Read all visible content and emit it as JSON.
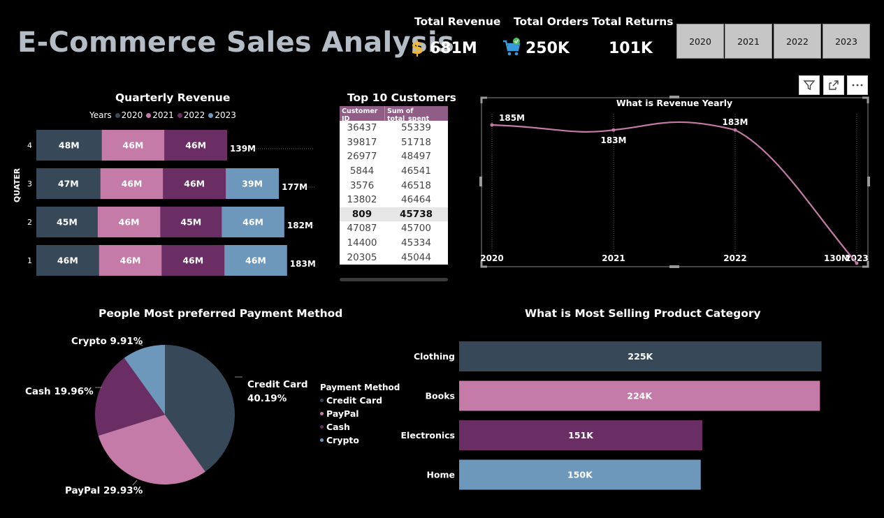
{
  "header": {
    "title": "E-Commerce Sales Analysis"
  },
  "kpis": [
    {
      "label": "Total Revenue",
      "value": "681M",
      "icon": "dollar-icon"
    },
    {
      "label": "Total Orders",
      "value": "250K",
      "icon": "cart-icon"
    },
    {
      "label": "Total Returns",
      "value": "101K"
    }
  ],
  "year_slicer": [
    "2020",
    "2021",
    "2022",
    "2023"
  ],
  "quarterly": {
    "title": "Quarterly Revenue",
    "legend_title": "Years",
    "axis_label": "QUATER",
    "colors": {
      "2020": "#374958",
      "2021": "#c47ba7",
      "2022": "#6a2e65",
      "2023": "#6d98bb"
    }
  },
  "top_customers": {
    "title": "Top 10 Customers",
    "columns": [
      "Customer ID",
      "Sum of total_spent"
    ],
    "rows": [
      [
        "36437",
        "55339"
      ],
      [
        "39817",
        "51718"
      ],
      [
        "26977",
        "48497"
      ],
      [
        "5844",
        "46541"
      ],
      [
        "3576",
        "46518"
      ],
      [
        "13802",
        "46464"
      ],
      [
        "809",
        "45738"
      ],
      [
        "47087",
        "45700"
      ],
      [
        "14400",
        "45334"
      ],
      [
        "20305",
        "45044"
      ]
    ]
  },
  "payment": {
    "title": "People Most preferred Payment Method",
    "legend_title": "Payment Method",
    "items": [
      {
        "name": "Credit Card",
        "pct": 40.19,
        "label": "Credit Card\n40.19%",
        "color": "#374958"
      },
      {
        "name": "PayPal",
        "pct": 29.93,
        "label": "PayPal 29.93%",
        "color": "#c47ba7"
      },
      {
        "name": "Cash",
        "pct": 19.96,
        "label": "Cash 19.96%",
        "color": "#6a2e65"
      },
      {
        "name": "Crypto",
        "pct": 9.91,
        "label": "Crypto 9.91%",
        "color": "#6d98bb"
      }
    ]
  },
  "chart_data": [
    {
      "type": "bar",
      "title": "Quarterly Revenue",
      "orientation": "horizontal-stacked",
      "categories": [
        "4",
        "3",
        "2",
        "1"
      ],
      "series": [
        {
          "name": "2020",
          "values": [
            48,
            47,
            45,
            46
          ],
          "labels": [
            "48M",
            "47M",
            "45M",
            "46M"
          ]
        },
        {
          "name": "2021",
          "values": [
            46,
            46,
            46,
            46
          ],
          "labels": [
            "46M",
            "46M",
            "46M",
            "46M"
          ]
        },
        {
          "name": "2022",
          "values": [
            46,
            46,
            45,
            46
          ],
          "labels": [
            "46M",
            "46M",
            "45M",
            "46M"
          ]
        },
        {
          "name": "2023",
          "values": [
            0,
            39,
            46,
            46
          ],
          "labels": [
            "",
            "39M",
            "46M",
            "46M"
          ]
        }
      ],
      "totals": [
        "139M",
        "177M",
        "182M",
        "183M"
      ],
      "ylabel": "QUATER"
    },
    {
      "type": "line",
      "title": "What is Revenue Yearly",
      "x": [
        "2020",
        "2021",
        "2022",
        "2023"
      ],
      "values": [
        185,
        183,
        183,
        130
      ],
      "labels": [
        "185M",
        "183M",
        "183M",
        "130M"
      ],
      "ylim": [
        125,
        190
      ]
    },
    {
      "type": "pie",
      "title": "People Most preferred Payment Method",
      "categories": [
        "Credit Card",
        "PayPal",
        "Cash",
        "Crypto"
      ],
      "values": [
        40.19,
        29.93,
        19.96,
        9.91
      ]
    },
    {
      "type": "bar",
      "title": "What is Most Selling Product Category",
      "orientation": "horizontal",
      "categories": [
        "Clothing",
        "Books",
        "Electronics",
        "Home"
      ],
      "values": [
        225,
        224,
        151,
        150
      ],
      "labels": [
        "225K",
        "224K",
        "151K",
        "150K"
      ],
      "colors": [
        "#374958",
        "#c47ba7",
        "#6a2e65",
        "#6d98bb"
      ]
    }
  ]
}
